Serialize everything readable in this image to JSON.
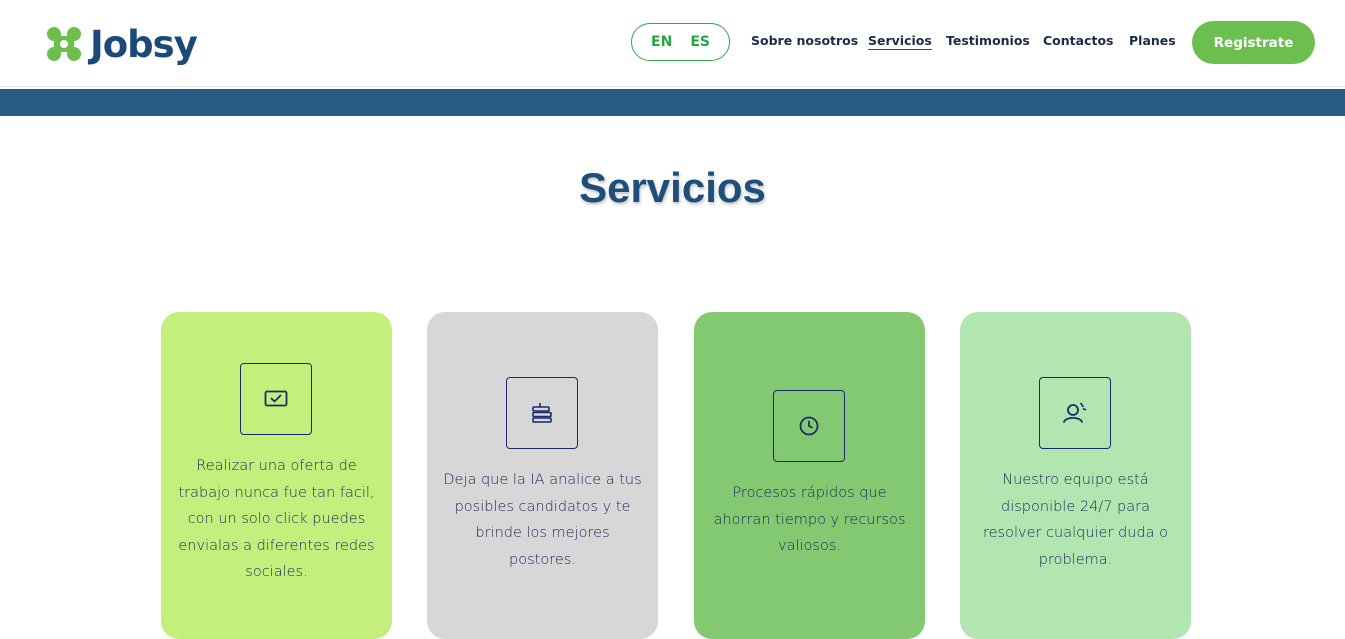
{
  "header": {
    "logo_text": "Jobsy",
    "languages": [
      "EN",
      "ES"
    ],
    "nav": [
      {
        "label": "Sobre nosotros",
        "active": false
      },
      {
        "label": "Servicios",
        "active": true
      },
      {
        "label": "Testimonios",
        "active": false
      },
      {
        "label": "Contactos",
        "active": false
      },
      {
        "label": "Planes",
        "active": false
      }
    ],
    "register_label": "Registrate"
  },
  "colors": {
    "brand_green": "#6cbf4f",
    "brand_blue": "#1b4a7a",
    "banner_blue": "#2a5b86"
  },
  "services": {
    "title": "Servicios",
    "cards": [
      {
        "icon": "checked-screen-icon",
        "color": "#c4ef7d",
        "text": "Realizar una oferta de trabajo nunca fue tan facil, con un solo click puedes envialas a diferentes redes sociales."
      },
      {
        "icon": "stacked-layers-icon",
        "color": "#d7d7d7",
        "text": "Deja que la IA analice a tus posibles candidatos y te brinde los mejores postores."
      },
      {
        "icon": "clock-icon",
        "color": "#83c972",
        "text": "Procesos rápidos que ahorran tiempo y recursos valiosos."
      },
      {
        "icon": "support-person-icon",
        "color": "#b1e6b0",
        "text": "Nuestro equipo está disponible 24/7 para resolver cualquier duda o problema."
      }
    ]
  }
}
